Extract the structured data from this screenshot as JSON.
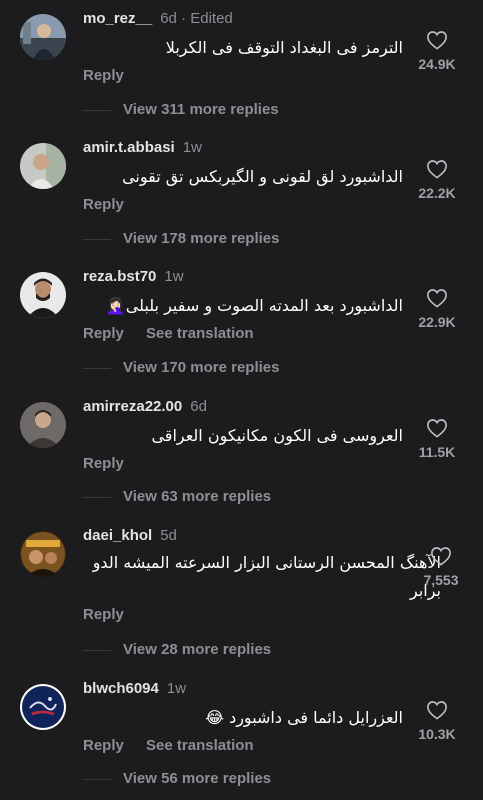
{
  "colors": {
    "background": "#1c1c1e",
    "username": "#e4e4e6",
    "secondary_text": "#8e8e93",
    "like_count": "#a1a1a6"
  },
  "comments": [
    {
      "username": "mo_rez__",
      "meta": "6d · Edited",
      "text": "الترمز فی البغداد التوقف فی الکربلا",
      "actions": [
        "Reply"
      ],
      "likes": "24.9K",
      "view_more": "View 311 more replies"
    },
    {
      "username": "amir.t.abbasi",
      "meta": "1w",
      "text": "الداشبورد لق لقونی و الگیربکس تق تقونی",
      "actions": [
        "Reply"
      ],
      "likes": "22.2K",
      "view_more": "View 178 more replies"
    },
    {
      "username": "reza.bst70",
      "meta": "1w",
      "text": "الداشبورد بعد المدته الصوت و سفیر بلبلی🤦🏻‍♀️",
      "actions": [
        "Reply",
        "See translation"
      ],
      "likes": "22.9K",
      "view_more": "View 170 more replies"
    },
    {
      "username": "amirreza22.00",
      "meta": "6d",
      "text": "العروسی فی الکون مکانیکون العراقی",
      "actions": [
        "Reply"
      ],
      "likes": "11.5K",
      "view_more": "View 63 more replies"
    },
    {
      "username": "daei_khol",
      "meta": "5d",
      "text": "الآهنگ المحسن الرستانی البزار السرعته المیشه الدو برابر",
      "actions": [
        "Reply"
      ],
      "likes": "7,553",
      "view_more": "View 28 more replies"
    },
    {
      "username": "blwch6094",
      "meta": "1w",
      "text": "العزرایل دائما فی داشبورد 😂",
      "actions": [
        "Reply",
        "See translation"
      ],
      "likes": "10.3K",
      "view_more": "View 56 more replies"
    }
  ]
}
